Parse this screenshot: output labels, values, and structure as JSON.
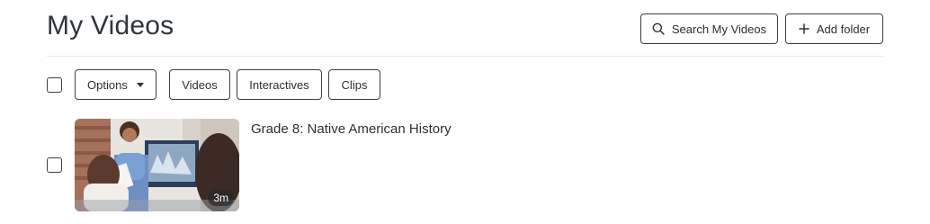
{
  "header": {
    "title": "My Videos",
    "search_label": "Search My Videos",
    "add_folder_label": "Add folder"
  },
  "toolbar": {
    "options_label": "Options",
    "filters": [
      "Videos",
      "Interactives",
      "Clips"
    ]
  },
  "videos": [
    {
      "title": "Grade 8: Native American History",
      "duration": "3m"
    }
  ]
}
